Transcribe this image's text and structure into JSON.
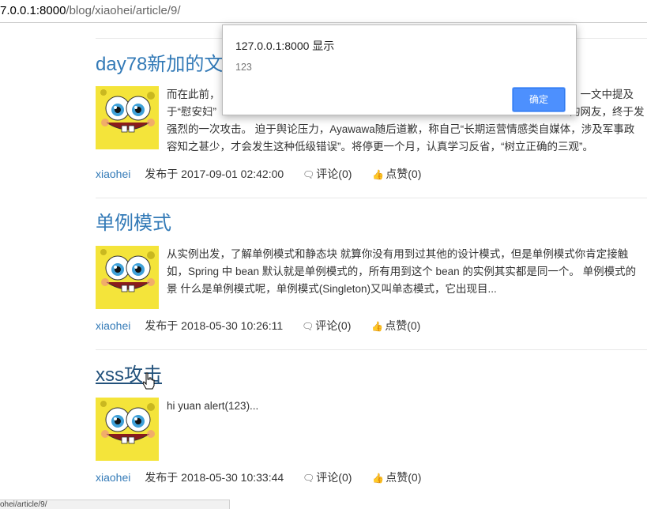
{
  "browser": {
    "url_host": "7.0.0.1:8000",
    "url_path": "/blog/xiaohei/article/9/",
    "status_text": "ohei/article/9/"
  },
  "alert": {
    "title": "127.0.0.1:8000 显示",
    "message": "123",
    "ok_label": "确定"
  },
  "articles": [
    {
      "title": "day78新加的文",
      "excerpt_lines": [
        "而在此前，",
        "于“慰安妇”",
        "强烈的一次攻击。 迫于舆论压力，Ayawawa随后道歉，称自己“长期运营情感类自媒体，涉及军事政",
        "容知之甚少，才会发生这种低级错误”。将停更一个月，认真学习反省，“树立正确的三观”。"
      ],
      "excerpt_right": [
        "》一文中提及",
        "的网友，终于发"
      ],
      "author": "xiaohei",
      "date": "发布于 2017-09-01 02:42:00",
      "comments": "评论(0)",
      "likes": "点赞(0)"
    },
    {
      "title": "单例模式",
      "excerpt_lines": [
        "从实例出发，了解单例模式和静态块 就算你没有用到过其他的设计模式，但是单例模式你肯定接触",
        "如，Spring 中 bean 默认就是单例模式的，所有用到这个 bean 的实例其实都是同一个。 单例模式的",
        "景 什么是单例模式呢，单例模式(Singleton)又叫单态模式，它出现目..."
      ],
      "author": "xiaohei",
      "date": "发布于 2018-05-30 10:26:11",
      "comments": "评论(0)",
      "likes": "点赞(0)"
    },
    {
      "title": "xss攻击",
      "excerpt_lines": [
        "hi yuan alert(123)..."
      ],
      "author": "xiaohei",
      "date": "发布于 2018-05-30 10:33:44",
      "comments": "评论(0)",
      "likes": "点赞(0)"
    }
  ],
  "icons": {
    "comment": "comment-icon",
    "like": "thumbs-up-icon"
  },
  "colors": {
    "link": "#337ab7",
    "button": "#4d90fe"
  }
}
